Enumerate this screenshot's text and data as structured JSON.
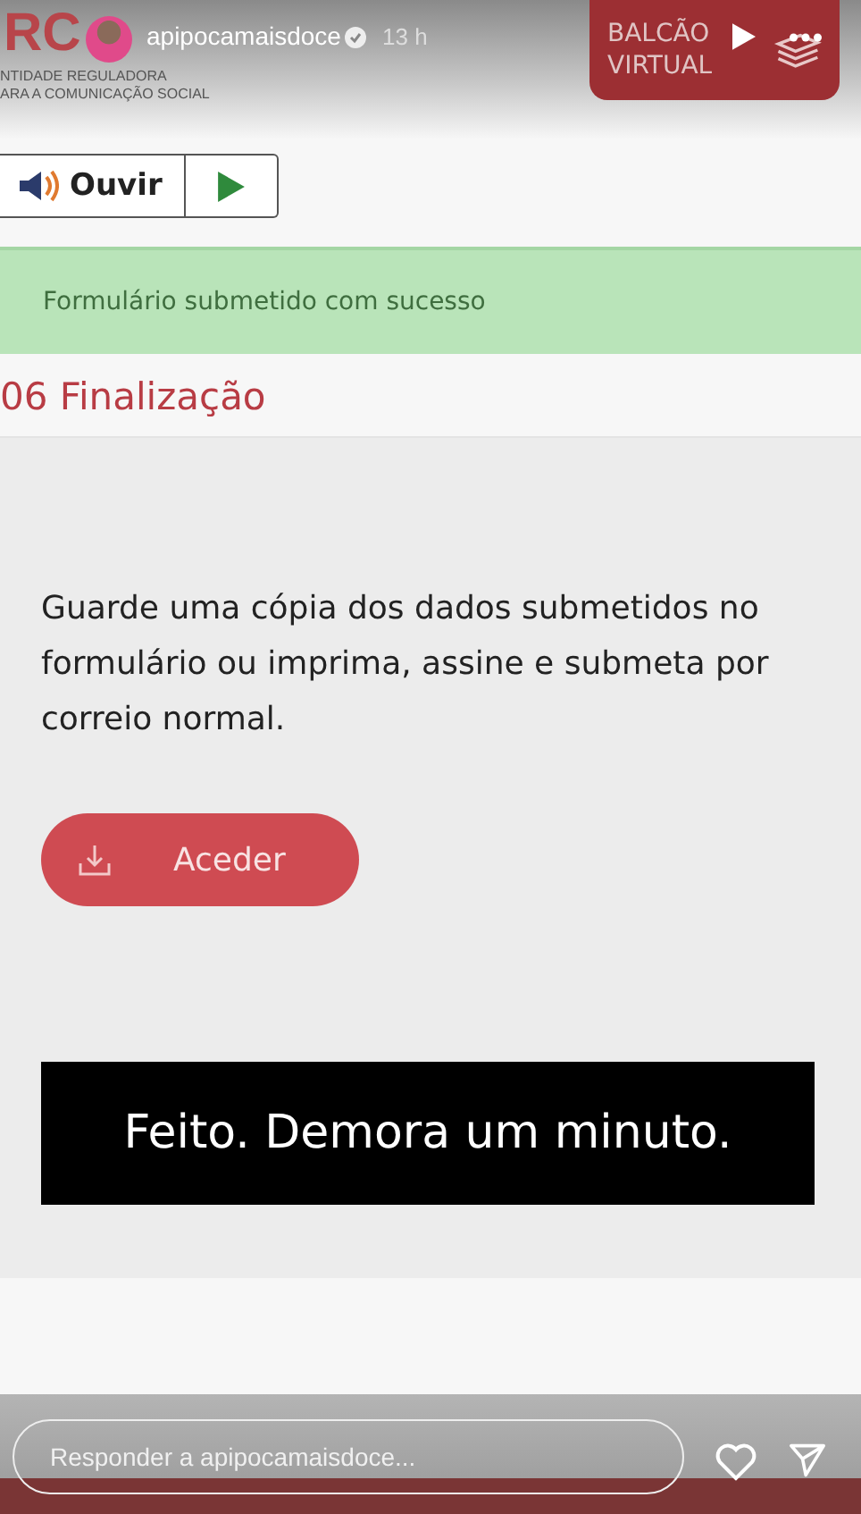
{
  "story": {
    "username": "apipocamaisdoce",
    "verified": true,
    "time": "13 h",
    "reply_placeholder": "Responder a apipocamaisdoce..."
  },
  "site": {
    "logo_letters": "RC",
    "logo_lines": [
      "NTIDADE REGULADORA",
      "ARA A COMUNICAÇÃO SOCIAL"
    ],
    "portal_button": [
      "BALCÃO",
      "VIRTUAL"
    ]
  },
  "listen": {
    "label": "Ouvir"
  },
  "alert": "Formulário submetido com sucesso",
  "section_title": "06 Finalização",
  "body": "Guarde uma cópia dos dados submetidos no formulário ou imprima, assine e submeta por correio normal.",
  "action_button": "Aceder",
  "caption": "Feito. Demora um minuto."
}
